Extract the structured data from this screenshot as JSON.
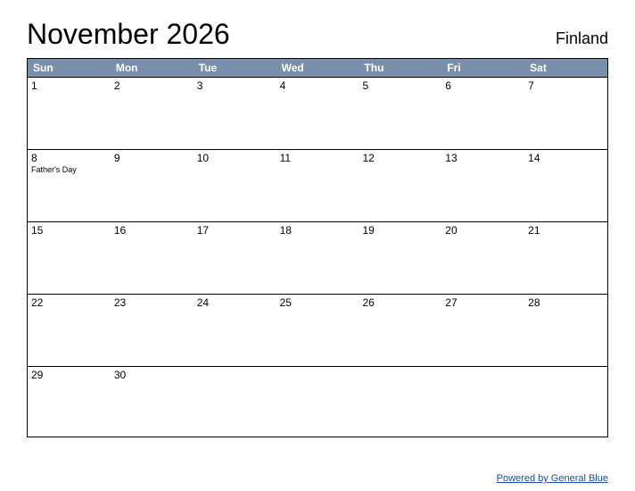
{
  "header": {
    "title": "November 2026",
    "country": "Finland"
  },
  "weekdays": [
    "Sun",
    "Mon",
    "Tue",
    "Wed",
    "Thu",
    "Fri",
    "Sat"
  ],
  "weeks": [
    [
      {
        "day": "1",
        "event": ""
      },
      {
        "day": "2",
        "event": ""
      },
      {
        "day": "3",
        "event": ""
      },
      {
        "day": "4",
        "event": ""
      },
      {
        "day": "5",
        "event": ""
      },
      {
        "day": "6",
        "event": ""
      },
      {
        "day": "7",
        "event": ""
      }
    ],
    [
      {
        "day": "8",
        "event": "Father's Day"
      },
      {
        "day": "9",
        "event": ""
      },
      {
        "day": "10",
        "event": ""
      },
      {
        "day": "11",
        "event": ""
      },
      {
        "day": "12",
        "event": ""
      },
      {
        "day": "13",
        "event": ""
      },
      {
        "day": "14",
        "event": ""
      }
    ],
    [
      {
        "day": "15",
        "event": ""
      },
      {
        "day": "16",
        "event": ""
      },
      {
        "day": "17",
        "event": ""
      },
      {
        "day": "18",
        "event": ""
      },
      {
        "day": "19",
        "event": ""
      },
      {
        "day": "20",
        "event": ""
      },
      {
        "day": "21",
        "event": ""
      }
    ],
    [
      {
        "day": "22",
        "event": ""
      },
      {
        "day": "23",
        "event": ""
      },
      {
        "day": "24",
        "event": ""
      },
      {
        "day": "25",
        "event": ""
      },
      {
        "day": "26",
        "event": ""
      },
      {
        "day": "27",
        "event": ""
      },
      {
        "day": "28",
        "event": ""
      }
    ],
    [
      {
        "day": "29",
        "event": ""
      },
      {
        "day": "30",
        "event": ""
      },
      {
        "day": "",
        "event": ""
      },
      {
        "day": "",
        "event": ""
      },
      {
        "day": "",
        "event": ""
      },
      {
        "day": "",
        "event": ""
      },
      {
        "day": "",
        "event": ""
      }
    ]
  ],
  "footer": {
    "link_text": "Powered by General Blue"
  }
}
